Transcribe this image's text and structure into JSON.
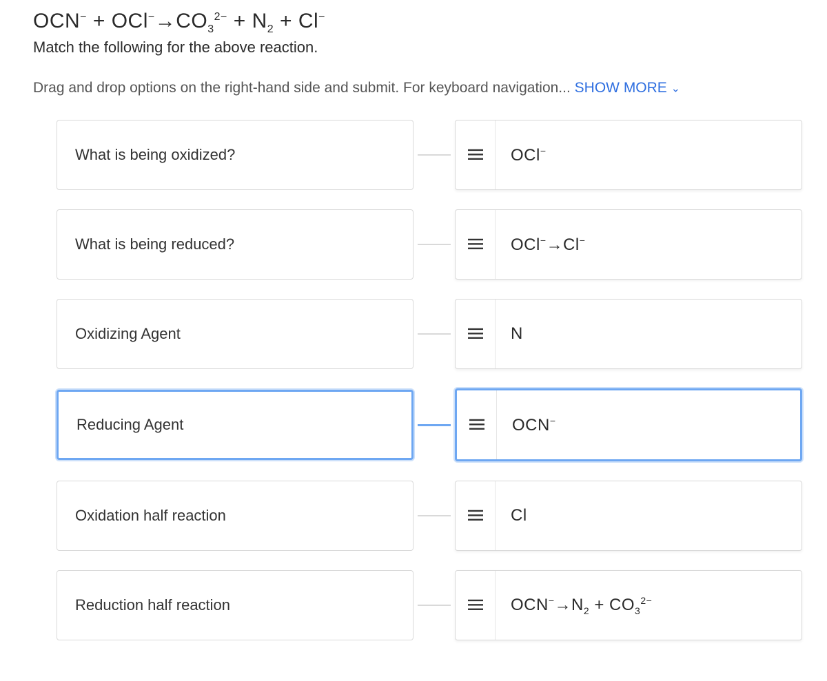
{
  "reaction_html": "OCN<sup>−</sup> + OCl<sup>−</sup>→CO<sub>3</sub><sup>2−</sup> + N<sub>2</sub> + Cl<sup>−</sup>",
  "subtitle": "Match the following for the above reaction.",
  "instructions_prefix": "Drag and drop options on the right-hand side and submit. For keyboard navigation... ",
  "show_more_label": "SHOW MORE",
  "rows": [
    {
      "prompt": "What is being oxidized?",
      "answer_html": "OCl<sup>−</sup>",
      "selected": false
    },
    {
      "prompt": "What is being reduced?",
      "answer_html": "OCl<sup>−</sup>→Cl<sup>−</sup>",
      "selected": false
    },
    {
      "prompt": "Oxidizing Agent",
      "answer_html": "N",
      "selected": false
    },
    {
      "prompt": "Reducing Agent",
      "answer_html": "OCN<sup>−</sup>",
      "selected": true
    },
    {
      "prompt": "Oxidation half reaction",
      "answer_html": "Cl",
      "selected": false
    },
    {
      "prompt": "Reduction half reaction",
      "answer_html": "OCN<sup>−</sup>→N<sub>2</sub> + CO<sub>3</sub><sup>2−</sup>",
      "selected": false
    }
  ]
}
